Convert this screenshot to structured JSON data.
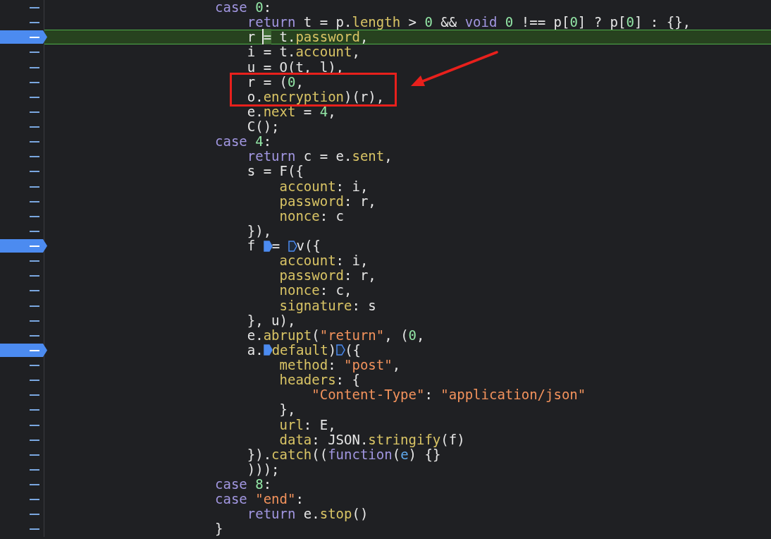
{
  "code_lines": [
    {
      "breakpoint": false,
      "paused": false,
      "boxed": false,
      "tokens": [
        {
          "kind": "keyword",
          "text": "case"
        },
        {
          "kind": "number",
          "text": " 0"
        },
        {
          "kind": "plain",
          "text": ":"
        }
      ]
    },
    {
      "breakpoint": false,
      "paused": false,
      "boxed": false,
      "tokens": [
        {
          "kind": "keyword",
          "text": "    return"
        },
        {
          "kind": "plain",
          "text": " t = p."
        },
        {
          "kind": "property",
          "text": "length"
        },
        {
          "kind": "plain",
          "text": " > "
        },
        {
          "kind": "number",
          "text": "0"
        },
        {
          "kind": "plain",
          "text": " && "
        },
        {
          "kind": "keyword",
          "text": "void"
        },
        {
          "kind": "number",
          "text": " 0"
        },
        {
          "kind": "plain",
          "text": " !== p["
        },
        {
          "kind": "number",
          "text": "0"
        },
        {
          "kind": "plain",
          "text": "] ? p["
        },
        {
          "kind": "number",
          "text": "0"
        },
        {
          "kind": "plain",
          "text": "] : {},"
        }
      ]
    },
    {
      "breakpoint": true,
      "paused": true,
      "boxed": false,
      "tokens": [
        {
          "kind": "plain",
          "text": "    r "
        },
        {
          "kind": "cursor",
          "text": "="
        },
        {
          "kind": "plain",
          "text": " t."
        },
        {
          "kind": "property",
          "text": "password"
        },
        {
          "kind": "plain",
          "text": ","
        }
      ]
    },
    {
      "breakpoint": false,
      "paused": false,
      "boxed": false,
      "tokens": [
        {
          "kind": "plain",
          "text": "    i = t."
        },
        {
          "kind": "property",
          "text": "account"
        },
        {
          "kind": "plain",
          "text": ","
        }
      ]
    },
    {
      "breakpoint": false,
      "paused": false,
      "boxed": false,
      "tokens": [
        {
          "kind": "plain",
          "text": "    u = O(t, l),"
        }
      ]
    },
    {
      "breakpoint": false,
      "paused": false,
      "boxed": true,
      "tokens": [
        {
          "kind": "plain",
          "text": "    r = ("
        },
        {
          "kind": "number",
          "text": "0"
        },
        {
          "kind": "plain",
          "text": ","
        }
      ]
    },
    {
      "breakpoint": false,
      "paused": false,
      "boxed": true,
      "tokens": [
        {
          "kind": "plain",
          "text": "    o."
        },
        {
          "kind": "property",
          "text": "encryption"
        },
        {
          "kind": "plain",
          "text": ")(r),"
        }
      ]
    },
    {
      "breakpoint": false,
      "paused": false,
      "boxed": false,
      "tokens": [
        {
          "kind": "plain",
          "text": "    e."
        },
        {
          "kind": "property",
          "text": "next"
        },
        {
          "kind": "plain",
          "text": " = "
        },
        {
          "kind": "number",
          "text": "4"
        },
        {
          "kind": "plain",
          "text": ","
        }
      ]
    },
    {
      "breakpoint": false,
      "paused": false,
      "boxed": false,
      "tokens": [
        {
          "kind": "plain",
          "text": "    C();"
        }
      ]
    },
    {
      "breakpoint": false,
      "paused": false,
      "boxed": false,
      "tokens": [
        {
          "kind": "keyword",
          "text": "case"
        },
        {
          "kind": "number",
          "text": " 4"
        },
        {
          "kind": "plain",
          "text": ":"
        }
      ]
    },
    {
      "breakpoint": false,
      "paused": false,
      "boxed": false,
      "tokens": [
        {
          "kind": "keyword",
          "text": "    return"
        },
        {
          "kind": "plain",
          "text": " c = e."
        },
        {
          "kind": "property",
          "text": "sent"
        },
        {
          "kind": "plain",
          "text": ","
        }
      ]
    },
    {
      "breakpoint": false,
      "paused": false,
      "boxed": false,
      "tokens": [
        {
          "kind": "plain",
          "text": "    s = F({"
        }
      ]
    },
    {
      "breakpoint": false,
      "paused": false,
      "boxed": false,
      "tokens": [
        {
          "kind": "property",
          "text": "        account"
        },
        {
          "kind": "plain",
          "text": ": i,"
        }
      ]
    },
    {
      "breakpoint": false,
      "paused": false,
      "boxed": false,
      "tokens": [
        {
          "kind": "property",
          "text": "        password"
        },
        {
          "kind": "plain",
          "text": ": r,"
        }
      ]
    },
    {
      "breakpoint": false,
      "paused": false,
      "boxed": false,
      "tokens": [
        {
          "kind": "property",
          "text": "        nonce"
        },
        {
          "kind": "plain",
          "text": ": c"
        }
      ]
    },
    {
      "breakpoint": false,
      "paused": false,
      "boxed": false,
      "tokens": [
        {
          "kind": "plain",
          "text": "    }),"
        }
      ]
    },
    {
      "breakpoint": true,
      "paused": false,
      "boxed": false,
      "tokens": [
        {
          "kind": "plain",
          "text": "    f "
        },
        {
          "kind": "marker",
          "active": true
        },
        {
          "kind": "plain",
          "text": "= "
        },
        {
          "kind": "marker",
          "active": false
        },
        {
          "kind": "plain",
          "text": "v({"
        }
      ]
    },
    {
      "breakpoint": false,
      "paused": false,
      "boxed": false,
      "tokens": [
        {
          "kind": "property",
          "text": "        account"
        },
        {
          "kind": "plain",
          "text": ": i,"
        }
      ]
    },
    {
      "breakpoint": false,
      "paused": false,
      "boxed": false,
      "tokens": [
        {
          "kind": "property",
          "text": "        password"
        },
        {
          "kind": "plain",
          "text": ": r,"
        }
      ]
    },
    {
      "breakpoint": false,
      "paused": false,
      "boxed": false,
      "tokens": [
        {
          "kind": "property",
          "text": "        nonce"
        },
        {
          "kind": "plain",
          "text": ": c,"
        }
      ]
    },
    {
      "breakpoint": false,
      "paused": false,
      "boxed": false,
      "tokens": [
        {
          "kind": "property",
          "text": "        signature"
        },
        {
          "kind": "plain",
          "text": ": s"
        }
      ]
    },
    {
      "breakpoint": false,
      "paused": false,
      "boxed": false,
      "tokens": [
        {
          "kind": "plain",
          "text": "    }, u),"
        }
      ]
    },
    {
      "breakpoint": false,
      "paused": false,
      "boxed": false,
      "tokens": [
        {
          "kind": "plain",
          "text": "    e."
        },
        {
          "kind": "property",
          "text": "abrupt"
        },
        {
          "kind": "plain",
          "text": "("
        },
        {
          "kind": "string",
          "text": "\"return\""
        },
        {
          "kind": "plain",
          "text": ", ("
        },
        {
          "kind": "number",
          "text": "0"
        },
        {
          "kind": "plain",
          "text": ","
        }
      ]
    },
    {
      "breakpoint": true,
      "paused": false,
      "boxed": false,
      "tokens": [
        {
          "kind": "plain",
          "text": "    a."
        },
        {
          "kind": "marker",
          "active": true
        },
        {
          "kind": "property",
          "text": "default"
        },
        {
          "kind": "plain",
          "text": ")"
        },
        {
          "kind": "marker",
          "active": false
        },
        {
          "kind": "plain",
          "text": "({"
        }
      ]
    },
    {
      "breakpoint": false,
      "paused": false,
      "boxed": false,
      "tokens": [
        {
          "kind": "property",
          "text": "        method"
        },
        {
          "kind": "plain",
          "text": ": "
        },
        {
          "kind": "string",
          "text": "\"post\""
        },
        {
          "kind": "plain",
          "text": ","
        }
      ]
    },
    {
      "breakpoint": false,
      "paused": false,
      "boxed": false,
      "tokens": [
        {
          "kind": "property",
          "text": "        headers"
        },
        {
          "kind": "plain",
          "text": ": {"
        }
      ]
    },
    {
      "breakpoint": false,
      "paused": false,
      "boxed": false,
      "tokens": [
        {
          "kind": "string",
          "text": "            \"Content-Type\""
        },
        {
          "kind": "plain",
          "text": ": "
        },
        {
          "kind": "string",
          "text": "\"application/json\""
        }
      ]
    },
    {
      "breakpoint": false,
      "paused": false,
      "boxed": false,
      "tokens": [
        {
          "kind": "plain",
          "text": "        },"
        }
      ]
    },
    {
      "breakpoint": false,
      "paused": false,
      "boxed": false,
      "tokens": [
        {
          "kind": "property",
          "text": "        url"
        },
        {
          "kind": "plain",
          "text": ": E,"
        }
      ]
    },
    {
      "breakpoint": false,
      "paused": false,
      "boxed": false,
      "tokens": [
        {
          "kind": "property",
          "text": "        data"
        },
        {
          "kind": "plain",
          "text": ": JSON."
        },
        {
          "kind": "property",
          "text": "stringify"
        },
        {
          "kind": "plain",
          "text": "(f)"
        }
      ]
    },
    {
      "breakpoint": false,
      "paused": false,
      "boxed": false,
      "tokens": [
        {
          "kind": "plain",
          "text": "    })."
        },
        {
          "kind": "property",
          "text": "catch"
        },
        {
          "kind": "plain",
          "text": "(("
        },
        {
          "kind": "keyword",
          "text": "function"
        },
        {
          "kind": "plain",
          "text": "("
        },
        {
          "kind": "parameter",
          "text": "e"
        },
        {
          "kind": "plain",
          "text": ") {}"
        }
      ]
    },
    {
      "breakpoint": false,
      "paused": false,
      "boxed": false,
      "tokens": [
        {
          "kind": "plain",
          "text": "    )));"
        }
      ]
    },
    {
      "breakpoint": false,
      "paused": false,
      "boxed": false,
      "tokens": [
        {
          "kind": "keyword",
          "text": "case"
        },
        {
          "kind": "number",
          "text": " 8"
        },
        {
          "kind": "plain",
          "text": ":"
        }
      ]
    },
    {
      "breakpoint": false,
      "paused": false,
      "boxed": false,
      "tokens": [
        {
          "kind": "keyword",
          "text": "case"
        },
        {
          "kind": "string",
          "text": " \"end\""
        },
        {
          "kind": "plain",
          "text": ":"
        }
      ]
    },
    {
      "breakpoint": false,
      "paused": false,
      "boxed": false,
      "tokens": [
        {
          "kind": "keyword",
          "text": "    return"
        },
        {
          "kind": "plain",
          "text": " e."
        },
        {
          "kind": "property",
          "text": "stop"
        },
        {
          "kind": "plain",
          "text": "()"
        }
      ]
    },
    {
      "breakpoint": false,
      "paused": false,
      "boxed": false,
      "tokens": [
        {
          "kind": "plain",
          "text": "}"
        }
      ]
    }
  ]
}
